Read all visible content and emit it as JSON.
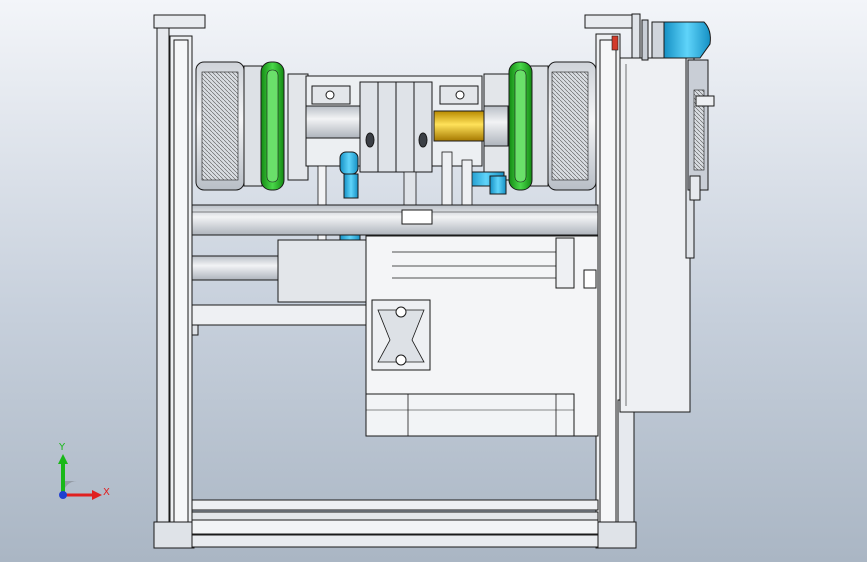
{
  "viewport": {
    "background_top": "#f3f5f9",
    "background_bottom": "#aab6c4"
  },
  "model": {
    "edge_color": "#1a1a1a",
    "part_fill": "#e6e9ee",
    "shaded_fill": "#c9ced6",
    "accent_green": "#2fb52f",
    "accent_cyan": "#27b6e8",
    "accent_gold": "#e8b400",
    "accent_red": "#d23a2a"
  },
  "triad": {
    "x_label": "X",
    "y_label": "Y",
    "x_color": "#e02020",
    "y_color": "#18b818",
    "z_color": "#2040d0",
    "icon": "axis-triad-icon"
  }
}
